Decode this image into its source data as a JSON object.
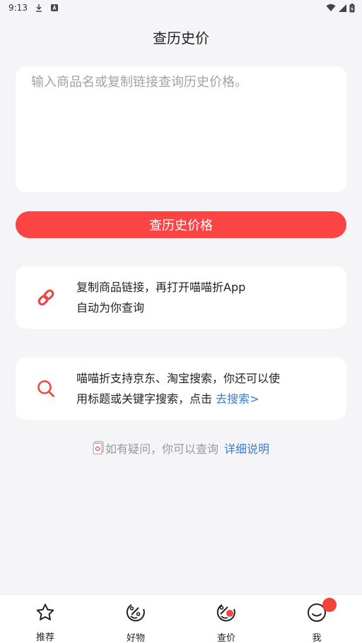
{
  "status_bar": {
    "time": "9:13",
    "icons": [
      "download-icon",
      "notification-a-icon",
      "wifi-icon",
      "signal-icon",
      "battery-icon"
    ]
  },
  "header": {
    "title": "查历史价"
  },
  "search_box": {
    "placeholder": "输入商品名或复制链接查询历史价格。",
    "value": ""
  },
  "query_button": {
    "label": "查历史价格"
  },
  "tips": {
    "link_tip": {
      "line1": "复制商品链接，再打开喵喵折App",
      "line2": "自动为你查询",
      "icon": "link-icon"
    },
    "search_tip": {
      "line1": "喵喵折支持京东、淘宝搜索，你还可以使",
      "line2_prefix": "用标题或关键字搜索，点击 ",
      "link_label": "去搜索>",
      "icon": "search-icon"
    }
  },
  "help": {
    "text": "如有疑问，你可以查询",
    "link_label": "详细说明",
    "icon": "document-icon"
  },
  "bottom_nav": {
    "items": [
      {
        "label": "推荐",
        "icon": "star-icon"
      },
      {
        "label": "好物",
        "icon": "percent-tag-icon"
      },
      {
        "label": "查价",
        "icon": "price-check-icon"
      },
      {
        "label": "我",
        "icon": "smiley-icon",
        "badge": true
      }
    ]
  },
  "colors": {
    "accent": "#fc4445",
    "link": "#3b7bd4",
    "background": "#f5f5f7"
  }
}
